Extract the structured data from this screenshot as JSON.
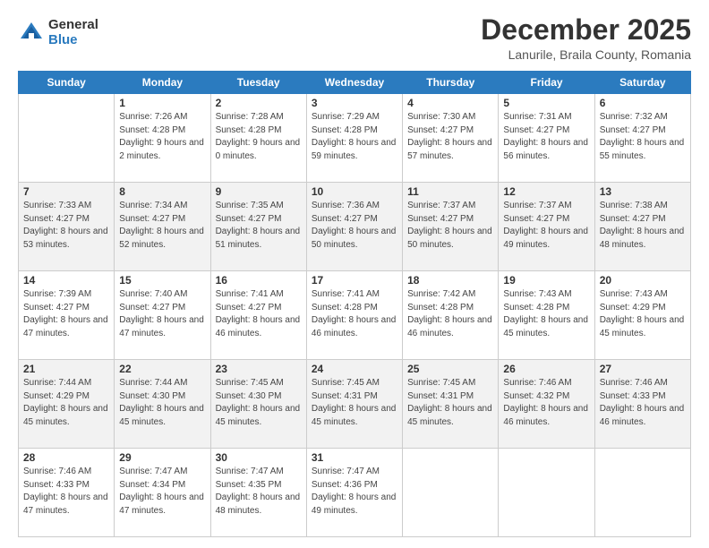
{
  "logo": {
    "general": "General",
    "blue": "Blue"
  },
  "header": {
    "month": "December 2025",
    "location": "Lanurile, Braila County, Romania"
  },
  "weekdays": [
    "Sunday",
    "Monday",
    "Tuesday",
    "Wednesday",
    "Thursday",
    "Friday",
    "Saturday"
  ],
  "weeks": [
    [
      {
        "day": "",
        "sunrise": "",
        "sunset": "",
        "daylight": ""
      },
      {
        "day": "1",
        "sunrise": "Sunrise: 7:26 AM",
        "sunset": "Sunset: 4:28 PM",
        "daylight": "Daylight: 9 hours and 2 minutes."
      },
      {
        "day": "2",
        "sunrise": "Sunrise: 7:28 AM",
        "sunset": "Sunset: 4:28 PM",
        "daylight": "Daylight: 9 hours and 0 minutes."
      },
      {
        "day": "3",
        "sunrise": "Sunrise: 7:29 AM",
        "sunset": "Sunset: 4:28 PM",
        "daylight": "Daylight: 8 hours and 59 minutes."
      },
      {
        "day": "4",
        "sunrise": "Sunrise: 7:30 AM",
        "sunset": "Sunset: 4:27 PM",
        "daylight": "Daylight: 8 hours and 57 minutes."
      },
      {
        "day": "5",
        "sunrise": "Sunrise: 7:31 AM",
        "sunset": "Sunset: 4:27 PM",
        "daylight": "Daylight: 8 hours and 56 minutes."
      },
      {
        "day": "6",
        "sunrise": "Sunrise: 7:32 AM",
        "sunset": "Sunset: 4:27 PM",
        "daylight": "Daylight: 8 hours and 55 minutes."
      }
    ],
    [
      {
        "day": "7",
        "sunrise": "Sunrise: 7:33 AM",
        "sunset": "Sunset: 4:27 PM",
        "daylight": "Daylight: 8 hours and 53 minutes."
      },
      {
        "day": "8",
        "sunrise": "Sunrise: 7:34 AM",
        "sunset": "Sunset: 4:27 PM",
        "daylight": "Daylight: 8 hours and 52 minutes."
      },
      {
        "day": "9",
        "sunrise": "Sunrise: 7:35 AM",
        "sunset": "Sunset: 4:27 PM",
        "daylight": "Daylight: 8 hours and 51 minutes."
      },
      {
        "day": "10",
        "sunrise": "Sunrise: 7:36 AM",
        "sunset": "Sunset: 4:27 PM",
        "daylight": "Daylight: 8 hours and 50 minutes."
      },
      {
        "day": "11",
        "sunrise": "Sunrise: 7:37 AM",
        "sunset": "Sunset: 4:27 PM",
        "daylight": "Daylight: 8 hours and 50 minutes."
      },
      {
        "day": "12",
        "sunrise": "Sunrise: 7:37 AM",
        "sunset": "Sunset: 4:27 PM",
        "daylight": "Daylight: 8 hours and 49 minutes."
      },
      {
        "day": "13",
        "sunrise": "Sunrise: 7:38 AM",
        "sunset": "Sunset: 4:27 PM",
        "daylight": "Daylight: 8 hours and 48 minutes."
      }
    ],
    [
      {
        "day": "14",
        "sunrise": "Sunrise: 7:39 AM",
        "sunset": "Sunset: 4:27 PM",
        "daylight": "Daylight: 8 hours and 47 minutes."
      },
      {
        "day": "15",
        "sunrise": "Sunrise: 7:40 AM",
        "sunset": "Sunset: 4:27 PM",
        "daylight": "Daylight: 8 hours and 47 minutes."
      },
      {
        "day": "16",
        "sunrise": "Sunrise: 7:41 AM",
        "sunset": "Sunset: 4:27 PM",
        "daylight": "Daylight: 8 hours and 46 minutes."
      },
      {
        "day": "17",
        "sunrise": "Sunrise: 7:41 AM",
        "sunset": "Sunset: 4:28 PM",
        "daylight": "Daylight: 8 hours and 46 minutes."
      },
      {
        "day": "18",
        "sunrise": "Sunrise: 7:42 AM",
        "sunset": "Sunset: 4:28 PM",
        "daylight": "Daylight: 8 hours and 46 minutes."
      },
      {
        "day": "19",
        "sunrise": "Sunrise: 7:43 AM",
        "sunset": "Sunset: 4:28 PM",
        "daylight": "Daylight: 8 hours and 45 minutes."
      },
      {
        "day": "20",
        "sunrise": "Sunrise: 7:43 AM",
        "sunset": "Sunset: 4:29 PM",
        "daylight": "Daylight: 8 hours and 45 minutes."
      }
    ],
    [
      {
        "day": "21",
        "sunrise": "Sunrise: 7:44 AM",
        "sunset": "Sunset: 4:29 PM",
        "daylight": "Daylight: 8 hours and 45 minutes."
      },
      {
        "day": "22",
        "sunrise": "Sunrise: 7:44 AM",
        "sunset": "Sunset: 4:30 PM",
        "daylight": "Daylight: 8 hours and 45 minutes."
      },
      {
        "day": "23",
        "sunrise": "Sunrise: 7:45 AM",
        "sunset": "Sunset: 4:30 PM",
        "daylight": "Daylight: 8 hours and 45 minutes."
      },
      {
        "day": "24",
        "sunrise": "Sunrise: 7:45 AM",
        "sunset": "Sunset: 4:31 PM",
        "daylight": "Daylight: 8 hours and 45 minutes."
      },
      {
        "day": "25",
        "sunrise": "Sunrise: 7:45 AM",
        "sunset": "Sunset: 4:31 PM",
        "daylight": "Daylight: 8 hours and 45 minutes."
      },
      {
        "day": "26",
        "sunrise": "Sunrise: 7:46 AM",
        "sunset": "Sunset: 4:32 PM",
        "daylight": "Daylight: 8 hours and 46 minutes."
      },
      {
        "day": "27",
        "sunrise": "Sunrise: 7:46 AM",
        "sunset": "Sunset: 4:33 PM",
        "daylight": "Daylight: 8 hours and 46 minutes."
      }
    ],
    [
      {
        "day": "28",
        "sunrise": "Sunrise: 7:46 AM",
        "sunset": "Sunset: 4:33 PM",
        "daylight": "Daylight: 8 hours and 47 minutes."
      },
      {
        "day": "29",
        "sunrise": "Sunrise: 7:47 AM",
        "sunset": "Sunset: 4:34 PM",
        "daylight": "Daylight: 8 hours and 47 minutes."
      },
      {
        "day": "30",
        "sunrise": "Sunrise: 7:47 AM",
        "sunset": "Sunset: 4:35 PM",
        "daylight": "Daylight: 8 hours and 48 minutes."
      },
      {
        "day": "31",
        "sunrise": "Sunrise: 7:47 AM",
        "sunset": "Sunset: 4:36 PM",
        "daylight": "Daylight: 8 hours and 49 minutes."
      },
      {
        "day": "",
        "sunrise": "",
        "sunset": "",
        "daylight": ""
      },
      {
        "day": "",
        "sunrise": "",
        "sunset": "",
        "daylight": ""
      },
      {
        "day": "",
        "sunrise": "",
        "sunset": "",
        "daylight": ""
      }
    ]
  ]
}
